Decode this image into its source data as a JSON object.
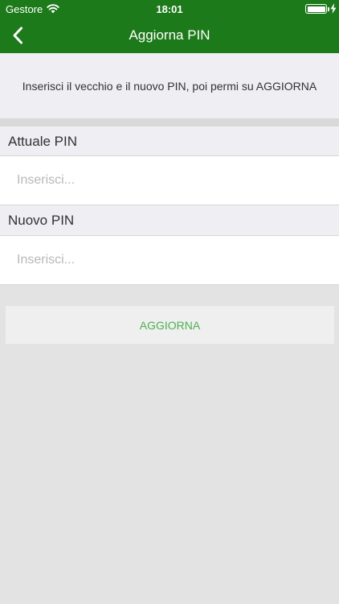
{
  "status_bar": {
    "carrier": "Gestore",
    "time": "18:01"
  },
  "navbar": {
    "title": "Aggiorna PIN",
    "back_icon": "chevron-left-icon"
  },
  "intro": {
    "text": "Inserisci il vecchio e il nuovo PIN, poi permi su AGGIORNA"
  },
  "fields": {
    "current_pin": {
      "label": "Attuale PIN",
      "placeholder": "Inserisci...",
      "value": ""
    },
    "new_pin": {
      "label": "Nuovo PIN",
      "placeholder": "Inserisci...",
      "value": ""
    }
  },
  "actions": {
    "update_label": "AGGIORNA"
  },
  "colors": {
    "header": "#1d7a1a",
    "accent": "#4caf50"
  }
}
